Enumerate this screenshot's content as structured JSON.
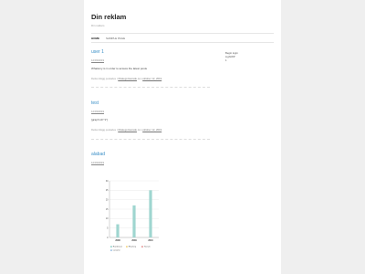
{
  "site": {
    "title": "Din reklam",
    "description": "Din reklam"
  },
  "nav": {
    "home": "HOME",
    "sample": "SAMPLE PAGE"
  },
  "sidebar": {
    "heading": "Begin login",
    "text": "LightWP",
    "number": "1"
  },
  "posts": [
    {
      "title": "user 1",
      "date": "12/03/2019",
      "body": "Whatsmy is in order to access the latest posts",
      "meta_prefix": "Detta inlägg postades i",
      "meta_cat": "Okategoriserade",
      "meta_mid": "den",
      "meta_date": "oktober 12, 2019"
    },
    {
      "title": "test",
      "date": "12/03/2019",
      "body": "[graph id=\"1\"]",
      "meta_prefix": "Detta inlägg postades i",
      "meta_cat": "Okategoriserade",
      "meta_mid": "den",
      "meta_date": "oktober 12, 2019"
    },
    {
      "title": "alabad",
      "date": "12/03/2019"
    }
  ],
  "chart_data": {
    "type": "bar",
    "categories": [
      "2008",
      "2009",
      "2010"
    ],
    "series": [
      {
        "name": "Rundresor",
        "values": [
          7,
          17,
          25
        ],
        "color": "#9fd6d0"
      },
      {
        "name": "Rhamey",
        "values": [
          0,
          0,
          0
        ],
        "color": "#f5d98b"
      },
      {
        "name": "Yezsch",
        "values": [
          0,
          0,
          0
        ],
        "color": "#e8a1a1"
      },
      {
        "name": "Laname",
        "values": [
          0,
          0,
          0
        ],
        "color": "#a7c7e7"
      }
    ],
    "ylim": [
      0,
      30
    ],
    "yticks": [
      "0",
      "5",
      "10",
      "15",
      "20",
      "25",
      "30"
    ],
    "legend_position": "bottom",
    "grid": true
  }
}
